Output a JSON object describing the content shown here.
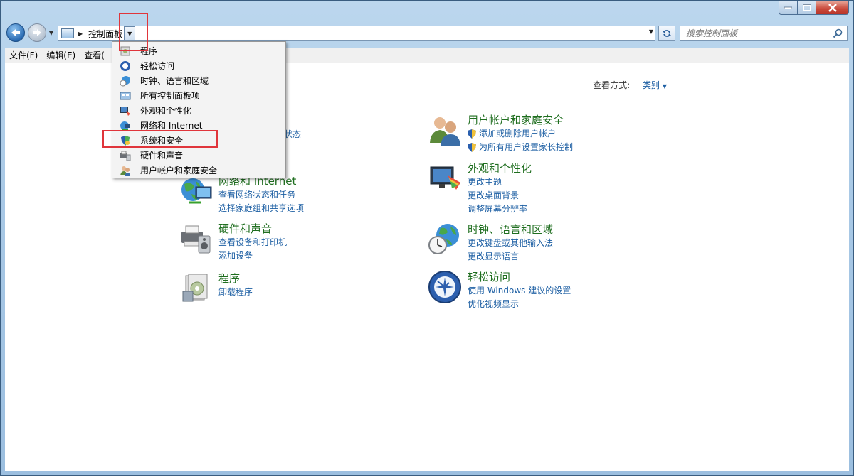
{
  "address": {
    "crumb": "控制面板",
    "search_placeholder": "搜索控制面板"
  },
  "menubar": {
    "items": [
      "文件(F)",
      "编辑(E)",
      "查看("
    ]
  },
  "view_by": {
    "label": "查看方式:",
    "value": "类别"
  },
  "dropdown": {
    "items": [
      "程序",
      "轻松访问",
      "时钟、语言和区域",
      "所有控制面板项",
      "外观和个性化",
      "网络和 Internet",
      "系统和安全",
      "硬件和声音",
      "用户帐户和家庭安全"
    ]
  },
  "partial_link": "状态",
  "categories": {
    "network": {
      "title": "网络和 Internet",
      "links": [
        "查看网络状态和任务",
        "选择家庭组和共享选项"
      ]
    },
    "hardware": {
      "title": "硬件和声音",
      "links": [
        "查看设备和打印机",
        "添加设备"
      ]
    },
    "programs": {
      "title": "程序",
      "links": [
        "卸载程序"
      ]
    },
    "users": {
      "title": "用户帐户和家庭安全",
      "links": [
        "添加或删除用户帐户",
        "为所有用户设置家长控制"
      ]
    },
    "appearance": {
      "title": "外观和个性化",
      "links": [
        "更改主题",
        "更改桌面背景",
        "调整屏幕分辨率"
      ]
    },
    "clock": {
      "title": "时钟、语言和区域",
      "links": [
        "更改键盘或其他输入法",
        "更改显示语言"
      ]
    },
    "access": {
      "title": "轻松访问",
      "links": [
        "使用 Windows 建议的设置",
        "优化视频显示"
      ]
    }
  },
  "colors": {
    "link": "#1d5fa3",
    "category_title": "#1f6e1f",
    "highlight": "#e0353b"
  }
}
